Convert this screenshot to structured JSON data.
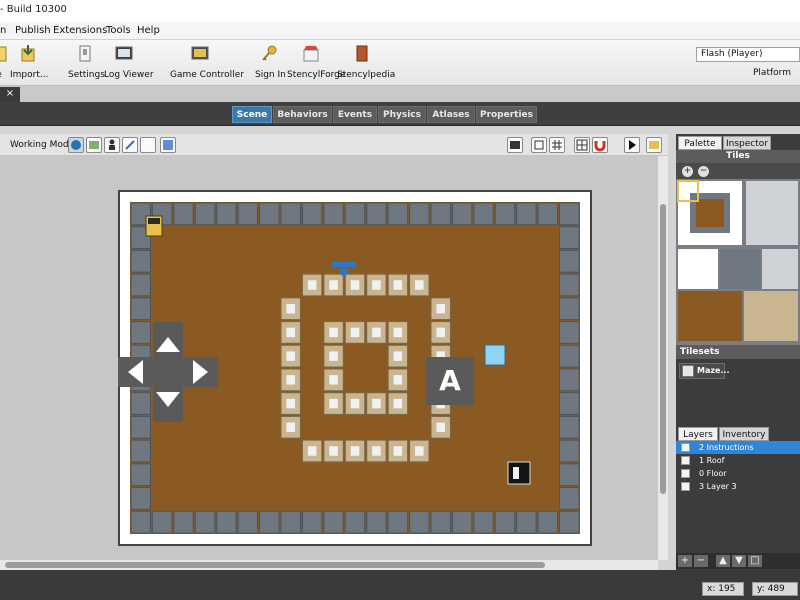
{
  "window": {
    "title": "- Build 10300"
  },
  "menu": [
    "n",
    "Publish",
    "Extensions",
    "Tools",
    "Help"
  ],
  "toolbar": {
    "buttons": [
      {
        "label": "e",
        "icon": "create-icon"
      },
      {
        "label": "Import...",
        "icon": "import-icon"
      },
      {
        "label": "Settings",
        "icon": "settings-icon"
      },
      {
        "label": "Log Viewer",
        "icon": "log-viewer-icon"
      },
      {
        "label": "Game Controller",
        "icon": "game-controller-icon"
      },
      {
        "label": "Sign In",
        "icon": "key-icon"
      },
      {
        "label": "StencylForge",
        "icon": "store-icon"
      },
      {
        "label": "Stencylpedia",
        "icon": "book-icon"
      }
    ],
    "target": {
      "selected": "Flash (Player)",
      "platform_label": "Platform"
    }
  },
  "doc_tab": {
    "close_label": "×"
  },
  "mode_tabs": [
    {
      "label": "Scene",
      "active": true
    },
    {
      "label": "Behaviors",
      "active": false
    },
    {
      "label": "Events",
      "active": false
    },
    {
      "label": "Physics",
      "active": false
    },
    {
      "label": "Atlases",
      "active": false
    },
    {
      "label": "Properties",
      "active": false
    }
  ],
  "editor": {
    "working_mode_label": "Working Mode",
    "working_mode_buttons": [
      "globe-icon",
      "image-icon",
      "actor-icon",
      "pencil-icon",
      "blank-icon",
      "color-icon"
    ],
    "view_buttons": [
      "screen-icon",
      "rect-icon",
      "grid-icon",
      "tile-grid-icon",
      "zoom-icon",
      "magnet-icon",
      "play-icon",
      "image-export-icon"
    ]
  },
  "scene": {
    "overlay_button_letter": "A",
    "maze_rows": [
      "#####################",
      "#...................#",
      "#...................#",
      "#.......######......#",
      "#......#......#.....#",
      "#......#.####.#.....#",
      "#......#.#..#.#.....#",
      "#......#.#..#.#.....#",
      "#......#.####.#.....#",
      "#......#......#.....#",
      "#.......######......#",
      "#...................#",
      "#...................#",
      "#####################"
    ]
  },
  "right_panel": {
    "tabs": [
      {
        "label": "Palette",
        "active": true
      },
      {
        "label": "Inspector",
        "active": false
      }
    ],
    "tiles_label": "Tiles",
    "zoom_in": "+",
    "zoom_out": "−",
    "tilesets_label": "Tilesets",
    "tileset_name": "Maze...",
    "layers_tabs": [
      {
        "label": "Layers",
        "active": true
      },
      {
        "label": "Inventory",
        "active": false
      }
    ],
    "layers": [
      {
        "label": "2  Instructions",
        "selected": true
      },
      {
        "label": "1  Roof",
        "selected": false
      },
      {
        "label": "0  Floor",
        "selected": false
      },
      {
        "label": "3  Layer 3",
        "selected": false
      }
    ],
    "layer_actions": [
      "+",
      "−",
      "▲",
      "▼",
      "□"
    ]
  },
  "status": {
    "x_label": "x:",
    "x_value": "195",
    "y_label": "y:",
    "y_value": "489"
  },
  "colors": {
    "dirt": "#8a5a22",
    "block": "#c9b58f",
    "wall": "#6f7780",
    "overlay": "#5a5a5a",
    "accent_blue": "#3b79a8"
  }
}
